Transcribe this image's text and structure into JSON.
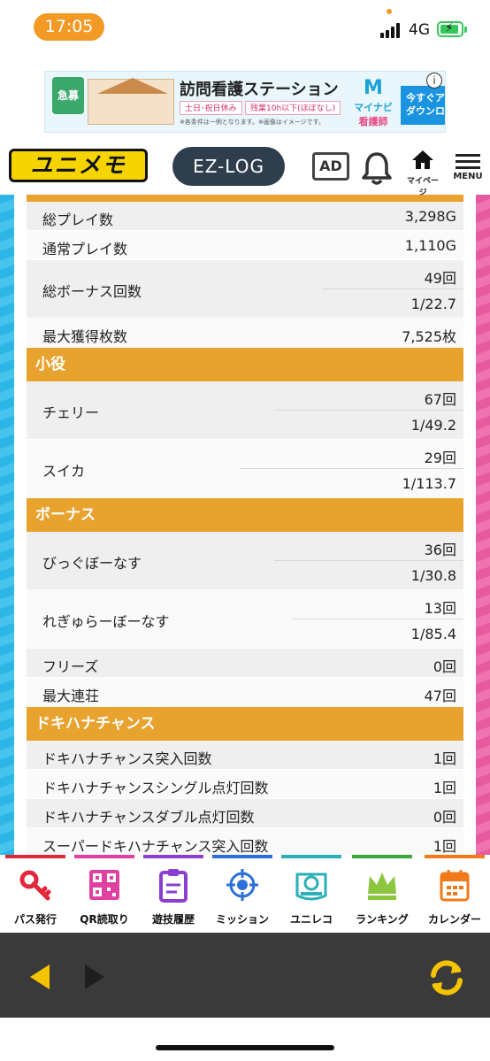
{
  "status_bar": {
    "time": "17:05",
    "network": "4G"
  },
  "ad_banner": {
    "badge": "急募",
    "title": "訪問看護ステーション",
    "tag1": "土日･祝日休み",
    "tag2": "残業10h以下(ほぼなし)",
    "note": "※各条件は一例となります。※画像はイメージです。",
    "brand_logo": "M",
    "brand_line1": "マイナビ",
    "brand_line2": "看護師",
    "cta_line1": "今すぐアプリ",
    "cta_line2": "ダウンロード",
    "info": "i"
  },
  "header": {
    "logo": "ユニメモ",
    "ezlog": "EZ-LOG",
    "ad_button": "AD",
    "mypage_label": "マイページ",
    "menu_label": "MENU"
  },
  "stats": {
    "rows_top": [
      {
        "label": "総プレイ数",
        "value": "3,298G"
      },
      {
        "label": "通常プレイ数",
        "value": "1,110G"
      }
    ],
    "bonus_total": {
      "label": "総ボーナス回数",
      "count": "49回",
      "rate": "1/22.7"
    },
    "max_coins": {
      "label": "最大獲得枚数",
      "value": "7,525枚"
    }
  },
  "section_koyaku": {
    "title": "小役",
    "cherry": {
      "label": "チェリー",
      "count": "67回",
      "rate": "1/49.2"
    },
    "suika": {
      "label": "スイカ",
      "count": "29回",
      "rate": "1/113.7"
    }
  },
  "section_bonus": {
    "title": "ボーナス",
    "big": {
      "label": "びっぐぼーなす",
      "count": "36回",
      "rate": "1/30.8"
    },
    "reg": {
      "label": "れぎゅらーぼーなす",
      "count": "13回",
      "rate": "1/85.4"
    },
    "freeze": {
      "label": "フリーズ",
      "value": "0回"
    },
    "max_streak": {
      "label": "最大連荘",
      "value": "47回"
    }
  },
  "section_doki": {
    "title": "ドキハナチャンス",
    "rows": [
      {
        "label": "ドキハナチャンス突入回数",
        "value": "1回"
      },
      {
        "label": "ドキハナチャンスシングル点灯回数",
        "value": "1回"
      },
      {
        "label": "ドキハナチャンスダブル点灯回数",
        "value": "0回"
      },
      {
        "label": "スーパードキハナチャンス突入回数",
        "value": "1回"
      }
    ]
  },
  "bottom_nav": {
    "items": [
      {
        "label": "パス発行",
        "icon": "key-icon",
        "color": "#e0283a"
      },
      {
        "label": "QR読取り",
        "icon": "qr-icon",
        "color": "#e040a0"
      },
      {
        "label": "遊技履歴",
        "icon": "clipboard-icon",
        "color": "#8a3fd1"
      },
      {
        "label": "ミッション",
        "icon": "target-icon",
        "color": "#2c6fd8"
      },
      {
        "label": "ユニレコ",
        "icon": "unireco-icon",
        "color": "#2bb0b8"
      },
      {
        "label": "ランキング",
        "icon": "crown-icon",
        "color": "#3aa83a"
      },
      {
        "label": "カレンダー",
        "icon": "calendar-icon",
        "color": "#f07a1a"
      }
    ]
  },
  "colors": {
    "accent_orange": "#e8a22e",
    "stripe_left": "#2bb6e6",
    "stripe_right": "#e75aa0",
    "toolbar": "#3a3a3a",
    "toolbar_icon": "#f5c400"
  }
}
